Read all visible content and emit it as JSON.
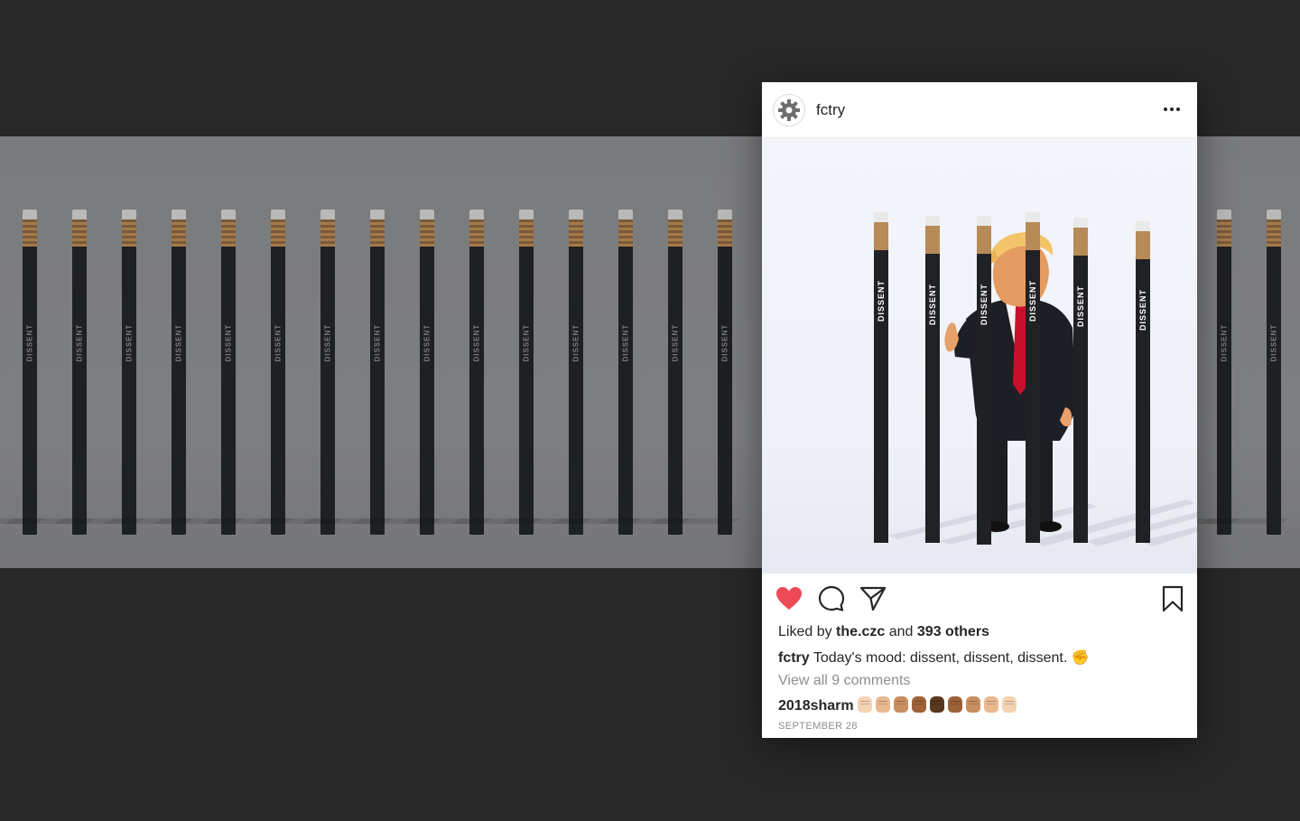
{
  "post": {
    "username": "fctry",
    "liked_by_prefix": "Liked by",
    "liked_by_user": "the.czc",
    "liked_by_and": "and",
    "liked_by_others": "393 others",
    "caption_user": "fctry",
    "caption_text": "Today's mood: dissent, dissent, dissent.",
    "caption_emoji": "✊",
    "view_all_comments": "View all 9 comments",
    "comment_user": "2018sharm",
    "comment_fist_colors": [
      "#f4d2b4",
      "#e8b98f",
      "#c98f5f",
      "#9c6239",
      "#5a3720",
      "#9c6239",
      "#c98f5f",
      "#e8b98f",
      "#f4d2b4"
    ],
    "date": "SEPTEMBER 28"
  },
  "pencil_label": "DISSENT",
  "colors": {
    "like_red": "#ed4956",
    "text": "#262626",
    "muted": "#8e8e8e",
    "page_background": "#282828"
  },
  "icons": {
    "avatar": "gear-icon",
    "more": "more-dots-icon",
    "like": "heart-icon",
    "comment": "comment-bubble-icon",
    "share": "paper-plane-icon",
    "save": "bookmark-icon"
  }
}
